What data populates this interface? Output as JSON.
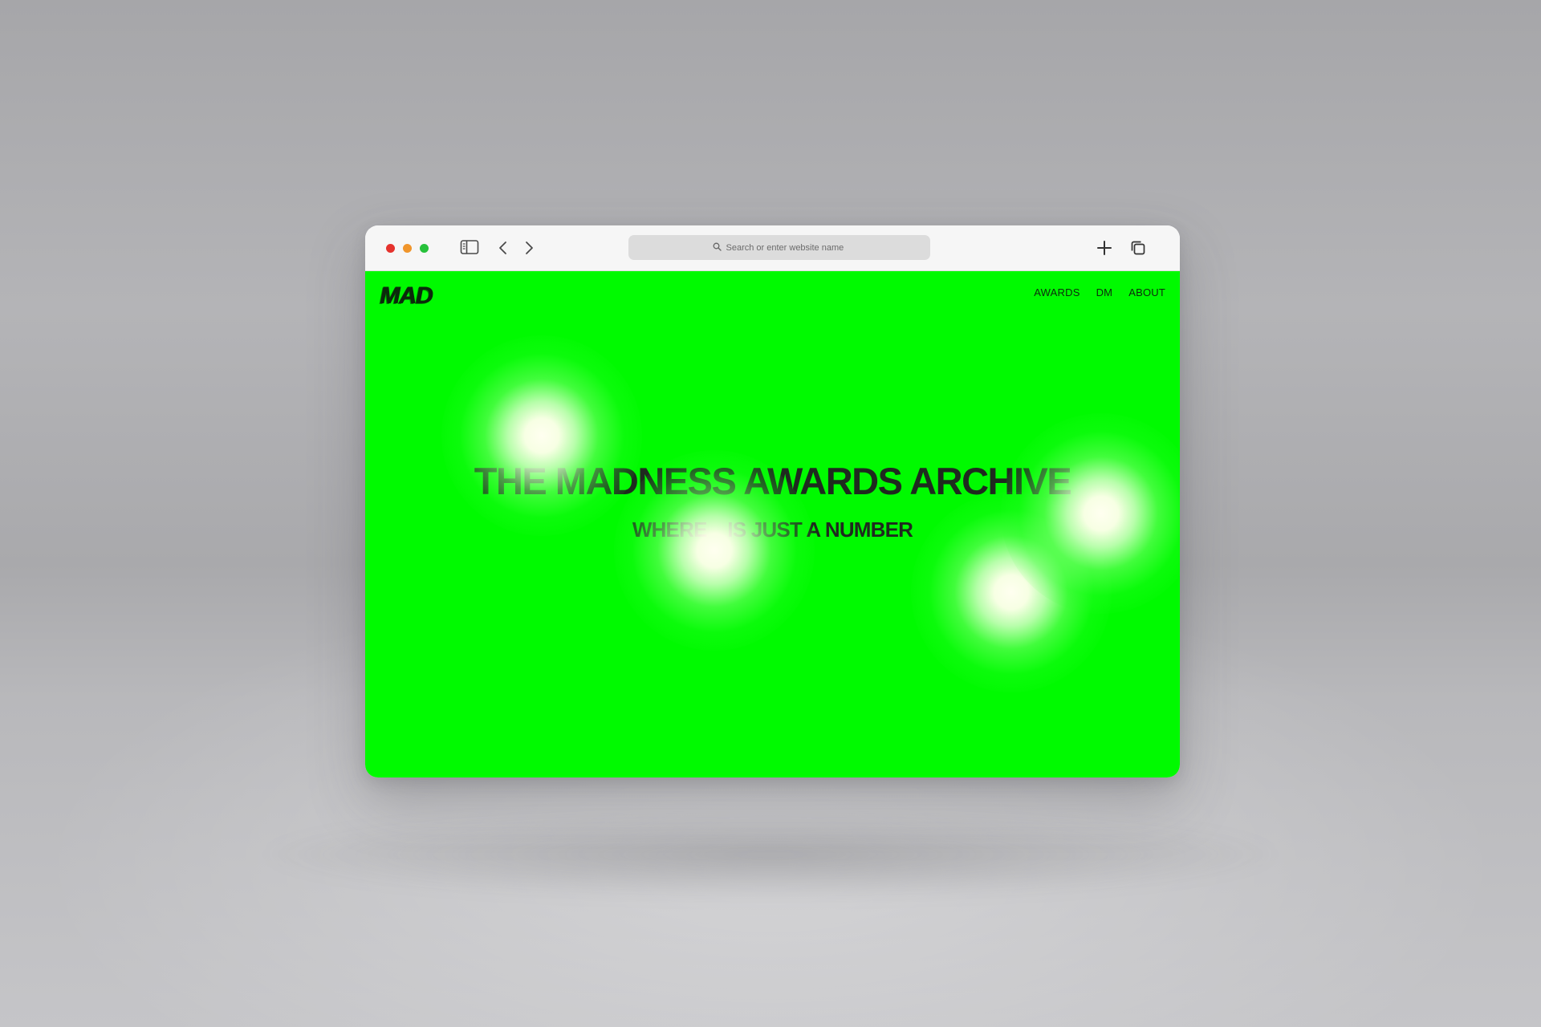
{
  "browser": {
    "traffic_lights": [
      {
        "name": "close",
        "color": "#e5322d"
      },
      {
        "name": "minimize",
        "color": "#f0952b"
      },
      {
        "name": "maximize",
        "color": "#27c13b"
      }
    ],
    "toolbar": {
      "sidebar_icon": "sidebar-icon",
      "back_icon": "chevron-left-icon",
      "forward_icon": "chevron-right-icon",
      "new_tab_icon": "plus-icon",
      "tabs_overview_icon": "tabs-overview-icon"
    },
    "address_bar": {
      "placeholder": "Search or enter website name",
      "icon": "search-icon"
    }
  },
  "site": {
    "background_color": "#00fa00",
    "logo": "MAD",
    "nav": [
      {
        "label": "AWARDS"
      },
      {
        "label": "DM"
      },
      {
        "label": "ABOUT"
      }
    ],
    "hero": {
      "title": "THE MADNESS AWARDS ARCHIVE",
      "subtitle": "WHERE    IS JUST A NUMBER"
    }
  }
}
